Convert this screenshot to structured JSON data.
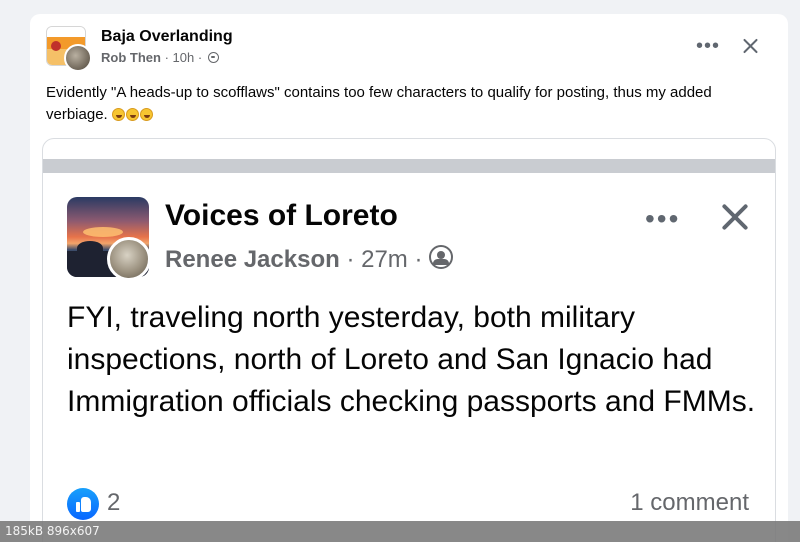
{
  "post": {
    "group_name": "Baja Overlanding",
    "author": "Rob Then",
    "time": "10h",
    "text": "Evidently \"A heads-up to scofflaws\" contains too few characters to qualify for posting, thus my added verbiage.",
    "emoji_icons": [
      "rolling-laughing-emoji",
      "rolling-laughing-emoji",
      "rolling-laughing-emoji"
    ],
    "more_label": "•••",
    "close_label": "close"
  },
  "shared": {
    "group_name": "Voices of Loreto",
    "author": "Renee Jackson",
    "time": "27m",
    "text": "FYI,  traveling north yesterday, both military inspections, north of Loreto and San Ignacio had Immigration officials checking passports and FMMs.",
    "more_label": "•••",
    "reactions": {
      "like_count": "2",
      "comments": "1 comment"
    }
  },
  "image_info": "185kB  896x607",
  "colors": {
    "like_blue": "#0866ff",
    "meta_gray": "#65676b",
    "text": "#050505"
  },
  "icons": {
    "privacy": "globe-icon",
    "group_privacy": "group-members-icon",
    "reaction": "like-icon"
  }
}
